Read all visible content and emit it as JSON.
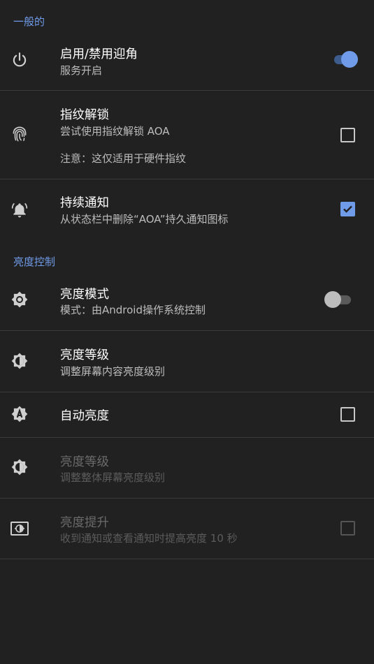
{
  "sections": {
    "general": "一般的",
    "brightness": "亮度控制"
  },
  "items": {
    "enable_corner": {
      "title": "启用/禁用迎角",
      "subtitle": "服务开启",
      "state": true
    },
    "fingerprint": {
      "title": "指纹解锁",
      "subtitle": "尝试使用指纹解锁 AOA",
      "note": "注意：这仅适用于硬件指纹",
      "checked": false
    },
    "persistent_notification": {
      "title": "持续通知",
      "subtitle": "从状态栏中删除“AOA”持久通知图标",
      "checked": true
    },
    "brightness_mode": {
      "title": "亮度模式",
      "subtitle": "模式：由Android操作系统控制",
      "state": false
    },
    "brightness_level": {
      "title": "亮度等级",
      "subtitle": "调整屏幕内容亮度级别"
    },
    "auto_brightness": {
      "title": "自动亮度",
      "checked": false
    },
    "brightness_level_overall": {
      "title": "亮度等级",
      "subtitle": "调整整体屏幕亮度级别",
      "disabled": true
    },
    "brightness_boost": {
      "title": "亮度提升",
      "subtitle": "收到通知或查看通知时提高亮度 10 秒",
      "checked": false,
      "disabled": true
    }
  },
  "colors": {
    "accent": "#6f9be8",
    "background": "#212121",
    "divider": "#3a3a3a"
  },
  "icons": {
    "enable_corner": "power-icon",
    "fingerprint": "fingerprint-icon",
    "persistent_notification": "bell-ring-icon",
    "brightness_mode": "brightness-sun-icon",
    "brightness_level": "brightness-half-icon",
    "auto_brightness": "brightness-auto-icon",
    "brightness_level_overall": "brightness-half-icon",
    "brightness_boost": "brightness-box-icon"
  }
}
